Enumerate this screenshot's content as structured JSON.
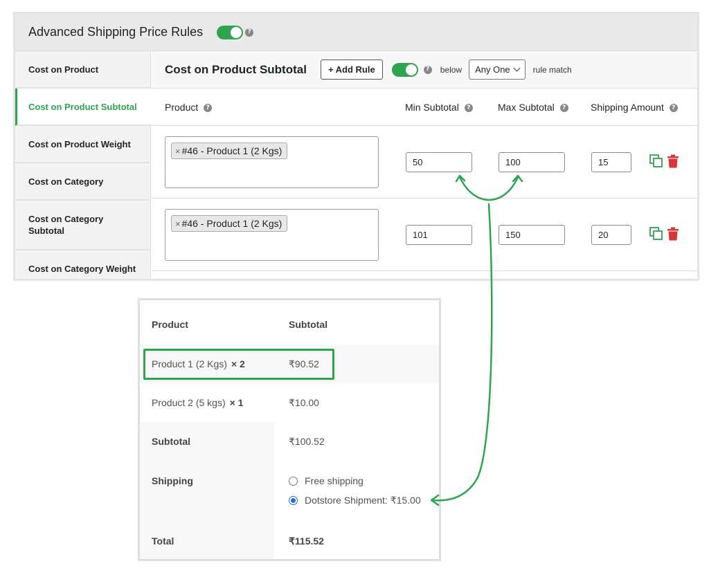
{
  "panel": {
    "title": "Advanced Shipping Price Rules"
  },
  "sidebar": {
    "items": [
      {
        "label": "Cost on Product",
        "active": false
      },
      {
        "label": "Cost on Product Subtotal",
        "active": true
      },
      {
        "label": "Cost on Product Weight",
        "active": false
      },
      {
        "label": "Cost on Category",
        "active": false
      },
      {
        "label": "Cost on Category Subtotal",
        "active": false
      },
      {
        "label": "Cost on Category Weight",
        "active": false
      }
    ]
  },
  "main": {
    "title": "Cost on Product Subtotal",
    "add_rule_label": "+ Add Rule",
    "below_label": "below",
    "match_select_value": "Any One",
    "rule_match_label": "rule match",
    "columns": {
      "product": "Product",
      "min_subtotal": "Min Subtotal",
      "max_subtotal": "Max Subtotal",
      "shipping_amount": "Shipping Amount"
    },
    "rules": [
      {
        "product_tag": "#46 - Product 1 (2 Kgs)",
        "min": "50",
        "max": "100",
        "amount": "15"
      },
      {
        "product_tag": "#46 - Product 1 (2 Kgs)",
        "min": "101",
        "max": "150",
        "amount": "20"
      }
    ]
  },
  "cart": {
    "header": {
      "product": "Product",
      "subtotal": "Subtotal"
    },
    "items": [
      {
        "name": "Product 1 (2 Kgs)",
        "qty": "× 2",
        "subtotal": "₹90.52"
      },
      {
        "name": "Product 2 (5 kgs)",
        "qty": "× 1",
        "subtotal": "₹10.00"
      }
    ],
    "subtotal_label": "Subtotal",
    "subtotal_value": "₹100.52",
    "shipping_label": "Shipping",
    "shipping_options": [
      {
        "label": "Free shipping",
        "selected": false
      },
      {
        "label": "Dotstore Shipment: ₹15.00",
        "selected": true
      }
    ],
    "total_label": "Total",
    "total_value": "₹115.52"
  },
  "colors": {
    "accent_green": "#2ea44f",
    "delete_red": "#d63638",
    "radio_blue": "#1e6fd9"
  },
  "icons": [
    "help-icon",
    "copy-icon",
    "trash-icon",
    "chevron-down-icon",
    "remove-x-icon"
  ]
}
